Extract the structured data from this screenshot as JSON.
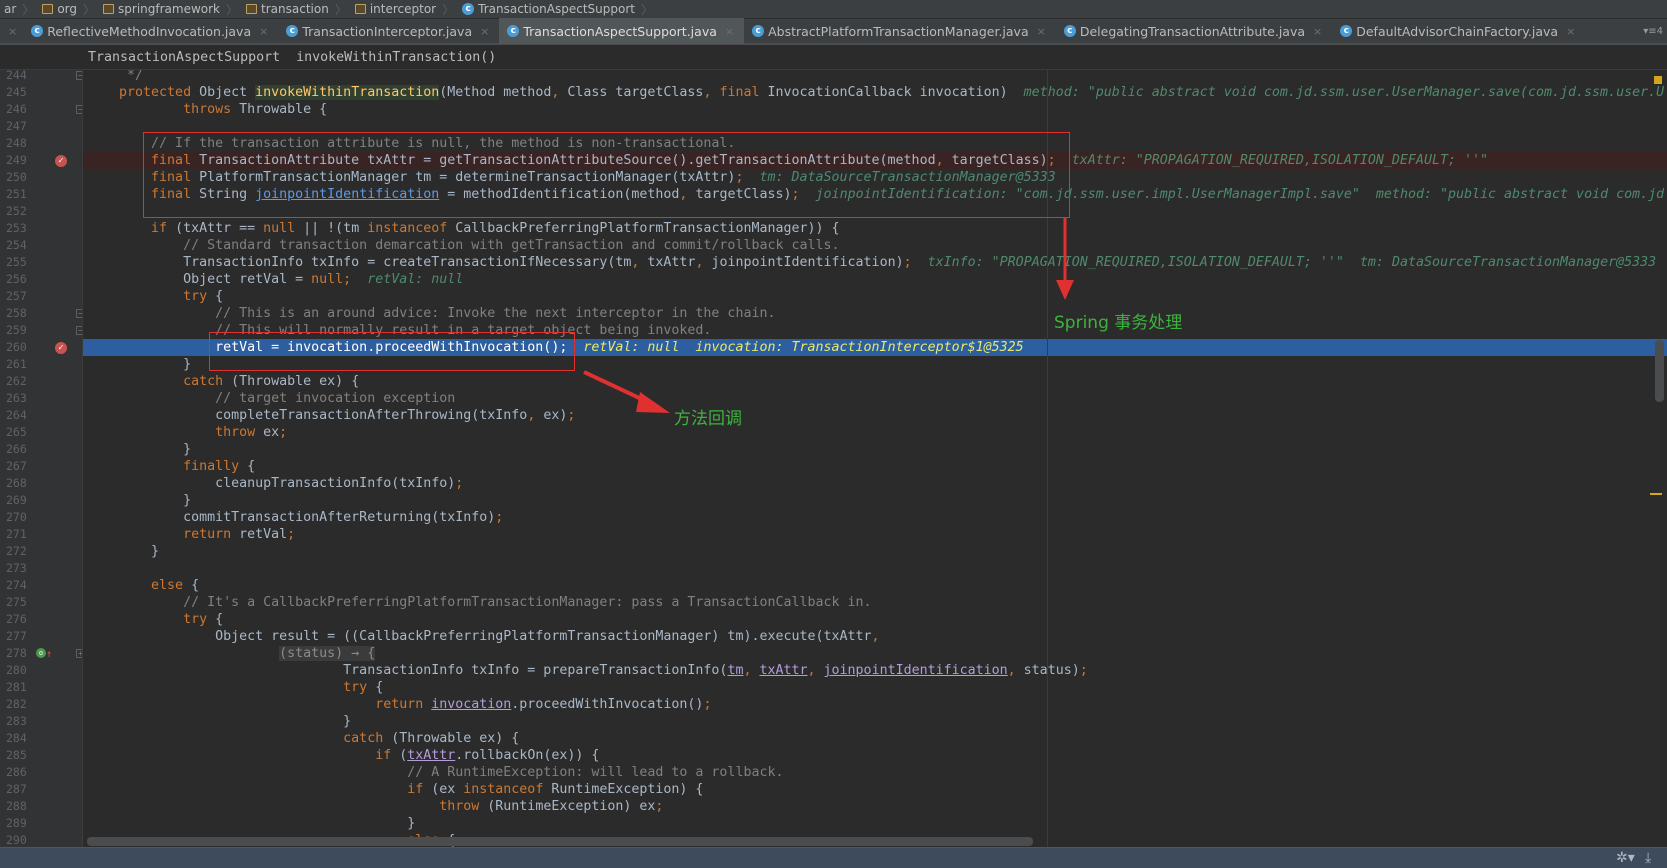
{
  "breadcrumbs": [
    "ar",
    "org",
    "springframework",
    "transaction",
    "interceptor",
    "TransactionAspectSupport"
  ],
  "tabs": [
    {
      "label": "ReflectiveMethodInvocation.java",
      "active": false
    },
    {
      "label": "TransactionInterceptor.java",
      "active": false
    },
    {
      "label": "TransactionAspectSupport.java",
      "active": true
    },
    {
      "label": "AbstractPlatformTransactionManager.java",
      "active": false
    },
    {
      "label": "DelegatingTransactionAttribute.java",
      "active": false
    },
    {
      "label": "DefaultAdvisorChainFactory.java",
      "active": false
    }
  ],
  "tab_overflow": "▾≡4",
  "method_breadcrumb": "TransactionAspectSupport  invokeWithinTransaction()",
  "annotations": {
    "spring_tx": "Spring 事务处理",
    "callback": "方法回调",
    "color": "#e03030",
    "text_color": "#3db33d"
  },
  "icons": {
    "breakpoint": "breakpoint-icon",
    "override": "override-icon",
    "settings": "gear-icon",
    "download": "download-icon"
  },
  "code": {
    "lines": [
      {
        "n": "244",
        "fold": true,
        "s": [
          [
            "c",
            "     */"
          ]
        ]
      },
      {
        "n": "245",
        "s": [
          [
            "k",
            "    protected "
          ],
          [
            "t",
            "Object "
          ],
          [
            "m",
            "invokeWithinTransaction"
          ],
          [
            "t",
            "(Method method"
          ],
          [
            "k",
            ", "
          ],
          [
            "t",
            "Class targetClass"
          ],
          [
            "k",
            ", final "
          ],
          [
            "t",
            "InvocationCallback invocation)  "
          ],
          [
            "h",
            "method: \"public abstract void com.jd.ssm.user.UserManager.save(com.jd.ssm.user.U"
          ]
        ]
      },
      {
        "n": "246",
        "fold": true,
        "s": [
          [
            "k",
            "            throws "
          ],
          [
            "t",
            "Throwable {"
          ]
        ]
      },
      {
        "n": "247",
        "s": []
      },
      {
        "n": "248",
        "s": [
          [
            "c",
            "        // If the transaction attribute is null, the method is non-transactional."
          ]
        ]
      },
      {
        "n": "249",
        "bp": true,
        "bg": "bpl",
        "s": [
          [
            "k",
            "        final "
          ],
          [
            "t",
            "TransactionAttribute txAttr = getTransactionAttributeSource().getTransactionAttribute(method"
          ],
          [
            "k",
            ", "
          ],
          [
            "t",
            "targetClass)"
          ],
          [
            "k",
            ";  "
          ],
          [
            "h",
            "txAttr: \"PROPAGATION_REQUIRED,ISOLATION_DEFAULT; ''\""
          ]
        ]
      },
      {
        "n": "250",
        "s": [
          [
            "k",
            "        final "
          ],
          [
            "t",
            "PlatformTransactionManager tm = determineTransactionManager(txAttr)"
          ],
          [
            "k",
            ";  "
          ],
          [
            "h",
            "tm: DataSourceTransactionManager@5333"
          ]
        ]
      },
      {
        "n": "251",
        "s": [
          [
            "k",
            "        final "
          ],
          [
            "t",
            "String "
          ],
          [
            "ub",
            "joinpointIdentification"
          ],
          [
            "t",
            " = methodIdentification(method"
          ],
          [
            "k",
            ", "
          ],
          [
            "t",
            "targetClass)"
          ],
          [
            "k",
            ";  "
          ],
          [
            "h",
            "joinpointIdentification: \"com.jd.ssm.user.impl.UserManagerImpl.save\"  method: \"public abstract void com.jd"
          ]
        ]
      },
      {
        "n": "252",
        "s": []
      },
      {
        "n": "253",
        "s": [
          [
            "k",
            "        if "
          ],
          [
            "t",
            "(txAttr == "
          ],
          [
            "k",
            "null "
          ],
          [
            "t",
            "|| !(tm "
          ],
          [
            "k",
            "instanceof "
          ],
          [
            "t",
            "CallbackPreferringPlatformTransactionManager)) {"
          ]
        ]
      },
      {
        "n": "254",
        "s": [
          [
            "c",
            "            // Standard transaction demarcation with getTransaction and commit/rollback calls."
          ]
        ]
      },
      {
        "n": "255",
        "s": [
          [
            "t",
            "            TransactionInfo txInfo = createTransactionIfNecessary(tm"
          ],
          [
            "k",
            ", "
          ],
          [
            "t",
            "txAttr"
          ],
          [
            "k",
            ", "
          ],
          [
            "t",
            "joinpointIdentification)"
          ],
          [
            "k",
            ";  "
          ],
          [
            "h",
            "txInfo: \"PROPAGATION_REQUIRED,ISOLATION_DEFAULT; ''\"  tm: DataSourceTransactionManager@5333"
          ]
        ]
      },
      {
        "n": "256",
        "s": [
          [
            "t",
            "            Object retVal = "
          ],
          [
            "k",
            "null;  "
          ],
          [
            "h",
            "retVal: null"
          ]
        ]
      },
      {
        "n": "257",
        "s": [
          [
            "k",
            "            try "
          ],
          [
            "t",
            "{"
          ]
        ]
      },
      {
        "n": "258",
        "fold": true,
        "s": [
          [
            "c",
            "                // This is an around advice: Invoke the next interceptor in the chain."
          ]
        ]
      },
      {
        "n": "259",
        "fold": true,
        "s": [
          [
            "c",
            "                // This will normally result in a target object being invoked."
          ]
        ]
      },
      {
        "n": "260",
        "bp": true,
        "bg": "exec",
        "s": [
          [
            "t",
            "                retVal = invocation.proceedWithInvocation()"
          ],
          [
            "k",
            ";  "
          ],
          [
            "h",
            "retVal: null  invocation: TransactionInterceptor$1@5325"
          ]
        ]
      },
      {
        "n": "261",
        "s": [
          [
            "t",
            "            }"
          ]
        ]
      },
      {
        "n": "262",
        "s": [
          [
            "k",
            "            catch "
          ],
          [
            "t",
            "(Throwable ex) {"
          ]
        ]
      },
      {
        "n": "263",
        "s": [
          [
            "c",
            "                // target invocation exception"
          ]
        ]
      },
      {
        "n": "264",
        "s": [
          [
            "t",
            "                completeTransactionAfterThrowing(txInfo"
          ],
          [
            "k",
            ", "
          ],
          [
            "t",
            "ex)"
          ],
          [
            "k",
            ";"
          ]
        ]
      },
      {
        "n": "265",
        "s": [
          [
            "k",
            "                throw "
          ],
          [
            "t",
            "ex"
          ],
          [
            "k",
            ";"
          ]
        ]
      },
      {
        "n": "266",
        "s": [
          [
            "t",
            "            }"
          ]
        ]
      },
      {
        "n": "267",
        "s": [
          [
            "k",
            "            finally "
          ],
          [
            "t",
            "{"
          ]
        ]
      },
      {
        "n": "268",
        "s": [
          [
            "t",
            "                cleanupTransactionInfo(txInfo)"
          ],
          [
            "k",
            ";"
          ]
        ]
      },
      {
        "n": "269",
        "s": [
          [
            "t",
            "            }"
          ]
        ]
      },
      {
        "n": "270",
        "s": [
          [
            "t",
            "            commitTransactionAfterReturning(txInfo)"
          ],
          [
            "k",
            ";"
          ]
        ]
      },
      {
        "n": "271",
        "s": [
          [
            "k",
            "            return "
          ],
          [
            "t",
            "retVal"
          ],
          [
            "k",
            ";"
          ]
        ]
      },
      {
        "n": "272",
        "s": [
          [
            "t",
            "        }"
          ]
        ]
      },
      {
        "n": "273",
        "s": []
      },
      {
        "n": "274",
        "s": [
          [
            "k",
            "        else "
          ],
          [
            "t",
            "{"
          ]
        ]
      },
      {
        "n": "275",
        "s": [
          [
            "c",
            "            // It's a CallbackPreferringPlatformTransactionManager: pass a TransactionCallback in."
          ]
        ]
      },
      {
        "n": "276",
        "s": [
          [
            "k",
            "            try "
          ],
          [
            "t",
            "{"
          ]
        ]
      },
      {
        "n": "277",
        "s": [
          [
            "t",
            "                Object result = ((CallbackPreferringPlatformTransactionManager) tm).execute(txAttr"
          ],
          [
            "k",
            ","
          ]
        ]
      },
      {
        "n": "278",
        "ov": true,
        "fold": true,
        "s": [
          [
            "t",
            "                        "
          ],
          [
            "f",
            "(status) → {"
          ]
        ]
      },
      {
        "n": "280",
        "s": [
          [
            "t",
            "                                TransactionInfo txInfo = prepareTransactionInfo("
          ],
          [
            "up",
            "tm"
          ],
          [
            "k",
            ", "
          ],
          [
            "up",
            "txAttr"
          ],
          [
            "k",
            ", "
          ],
          [
            "up",
            "joinpointIdentification"
          ],
          [
            "k",
            ", "
          ],
          [
            "t",
            "status)"
          ],
          [
            "k",
            ";"
          ]
        ]
      },
      {
        "n": "281",
        "s": [
          [
            "k",
            "                                try "
          ],
          [
            "t",
            "{"
          ]
        ]
      },
      {
        "n": "282",
        "s": [
          [
            "k",
            "                                    return "
          ],
          [
            "up",
            "invocation"
          ],
          [
            "t",
            ".proceedWithInvocation()"
          ],
          [
            "k",
            ";"
          ]
        ]
      },
      {
        "n": "283",
        "s": [
          [
            "t",
            "                                }"
          ]
        ]
      },
      {
        "n": "284",
        "s": [
          [
            "k",
            "                                catch "
          ],
          [
            "t",
            "(Throwable ex) {"
          ]
        ]
      },
      {
        "n": "285",
        "s": [
          [
            "k",
            "                                    if "
          ],
          [
            "t",
            "("
          ],
          [
            "up",
            "txAttr"
          ],
          [
            "t",
            ".rollbackOn(ex)) {"
          ]
        ]
      },
      {
        "n": "286",
        "s": [
          [
            "c",
            "                                        // A RuntimeException: will lead to a rollback."
          ]
        ]
      },
      {
        "n": "287",
        "s": [
          [
            "k",
            "                                        if "
          ],
          [
            "t",
            "(ex "
          ],
          [
            "k",
            "instanceof "
          ],
          [
            "t",
            "RuntimeException) {"
          ]
        ]
      },
      {
        "n": "288",
        "s": [
          [
            "k",
            "                                            throw "
          ],
          [
            "t",
            "(RuntimeException) ex"
          ],
          [
            "k",
            ";"
          ]
        ]
      },
      {
        "n": "289",
        "s": [
          [
            "t",
            "                                        }"
          ]
        ]
      },
      {
        "n": "290",
        "s": [
          [
            "k",
            "                                        else "
          ],
          [
            "t",
            "{"
          ]
        ]
      }
    ]
  }
}
